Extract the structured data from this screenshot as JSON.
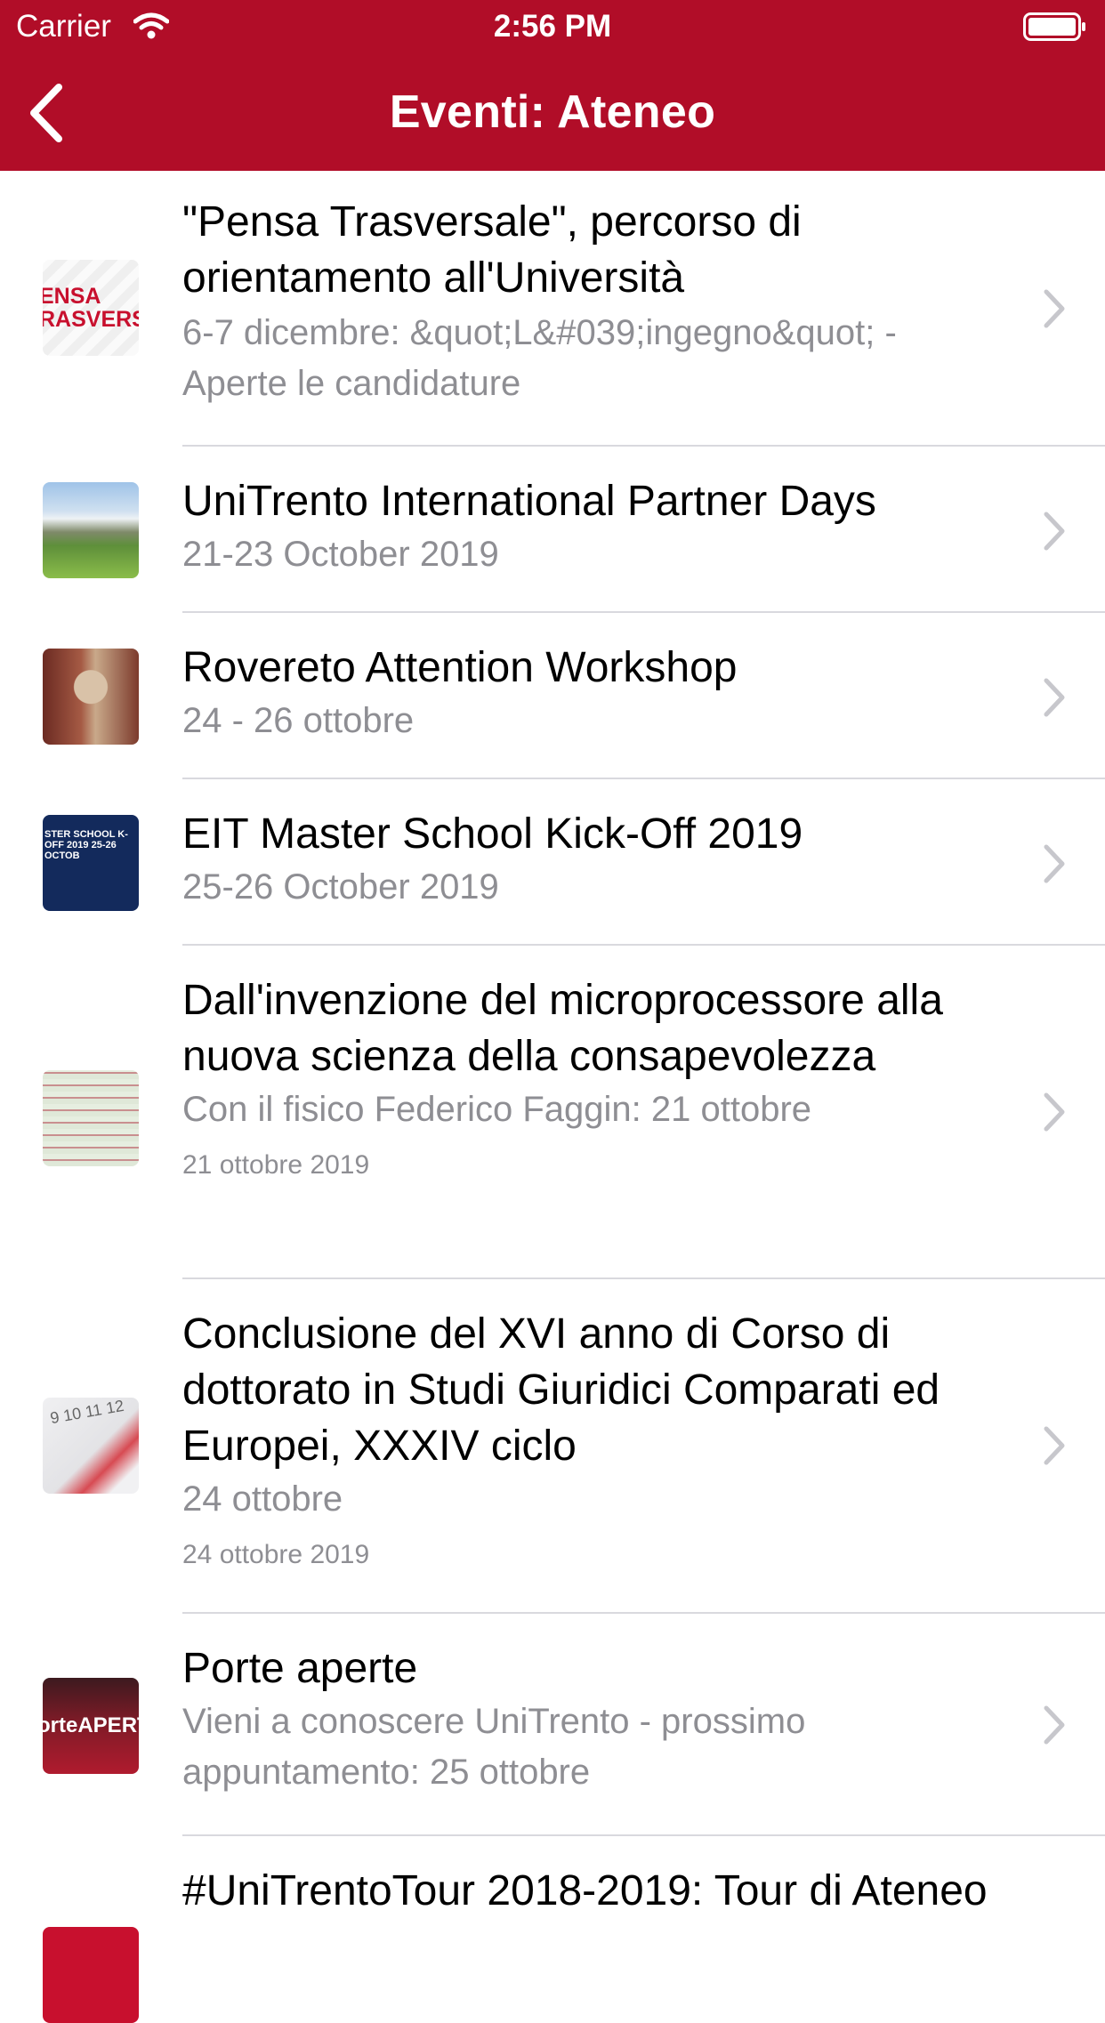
{
  "status_bar": {
    "carrier": "Carrier",
    "time": "2:56 PM"
  },
  "nav": {
    "title": "Eventi: Ateneo",
    "back_icon": "chevron-left-icon"
  },
  "colors": {
    "accent": "#b10d28",
    "secondary_text": "#8e8e93",
    "separator": "#d9d9de"
  },
  "events": [
    {
      "title": "\"Pensa Trasversale\", percorso di orientamento all'Università",
      "subtitle": "6-7 dicembre: &quot;L&#039;ingegno&quot; - Aperte le candidature",
      "date": "",
      "thumb_text": "ENSA RASVERSAL"
    },
    {
      "title": "UniTrento International Partner Days",
      "subtitle": "21-23 October 2019",
      "date": "",
      "thumb_text": ""
    },
    {
      "title": "Rovereto Attention Workshop",
      "subtitle": "24 - 26 ottobre",
      "date": "",
      "thumb_text": ""
    },
    {
      "title": "EIT Master School Kick-Off 2019",
      "subtitle": "25-26 October 2019",
      "date": "",
      "thumb_text": "STER SCHOOL K-OFF 2019 25-26 OCTOB"
    },
    {
      "title": "Dall'invenzione del microprocessore alla nuova scienza della consapevolezza",
      "subtitle": "Con il fisico Federico Faggin: 21 ottobre",
      "date": "21 ottobre 2019",
      "thumb_text": ""
    },
    {
      "title": "Conclusione del XVI anno di Corso di dottorato in Studi Giuridici Comparati ed Europei, XXXIV ciclo",
      "subtitle": "24 ottobre",
      "date": "24 ottobre 2019",
      "thumb_text": "9 10 11 12"
    },
    {
      "title": "Porte aperte",
      "subtitle": "Vieni a conoscere UniTrento - prossimo appuntamento: 25 ottobre",
      "date": "",
      "thumb_text": "orteAPERT"
    },
    {
      "title": "#UniTrentoTour 2018-2019: Tour di Ateneo",
      "subtitle": "",
      "date": "",
      "thumb_text": ""
    }
  ]
}
